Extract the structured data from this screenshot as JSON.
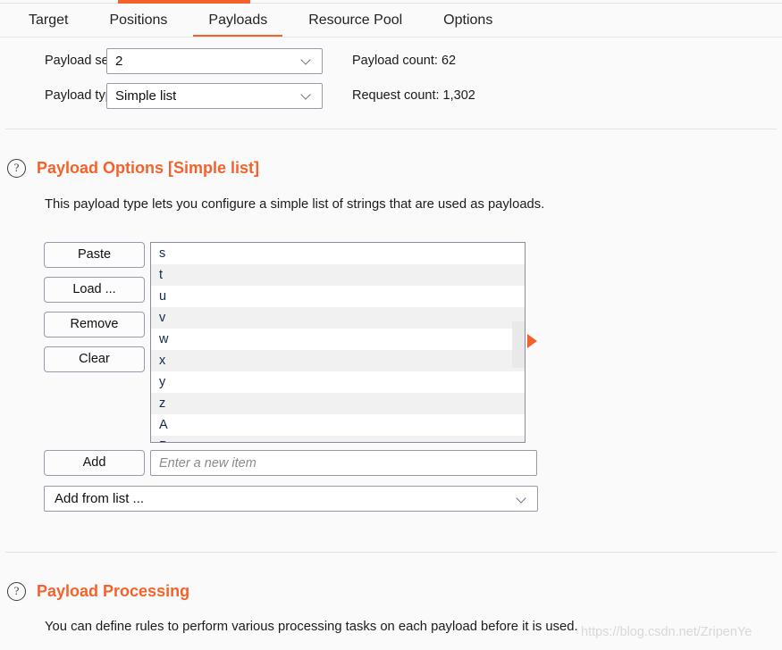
{
  "tabs": [
    {
      "label": "Target",
      "active": false
    },
    {
      "label": "Positions",
      "active": false
    },
    {
      "label": "Payloads",
      "active": true
    },
    {
      "label": "Resource Pool",
      "active": false
    },
    {
      "label": "Options",
      "active": false
    }
  ],
  "form": {
    "payload_set_label": "Payload set:",
    "payload_set_value": "2",
    "payload_type_label": "Payload type:",
    "payload_type_value": "Simple list",
    "payload_count_label": "Payload count:",
    "payload_count_value": "62",
    "request_count_label": "Request count:",
    "request_count_value": "1,302"
  },
  "payload_options": {
    "help_icon": "question-mark-icon",
    "title": "Payload Options [Simple list]",
    "description": "This payload type lets you configure a simple list of strings that are used as payloads.",
    "buttons": [
      {
        "label": "Paste"
      },
      {
        "label": "Load ..."
      },
      {
        "label": "Remove"
      },
      {
        "label": "Clear"
      }
    ],
    "list_items": [
      "s",
      "t",
      "u",
      "v",
      "w",
      "x",
      "y",
      "z",
      "A",
      "B"
    ],
    "add_button_label": "Add",
    "add_input_value": "",
    "add_input_placeholder": "Enter a new item",
    "add_from_list_label": "Add from list ...",
    "pointer_icon": "play-triangle-icon",
    "scrollbar_icon": "vertical-scrollbar"
  },
  "payload_processing": {
    "help_icon": "question-mark-icon",
    "title": "Payload Processing",
    "description": "You can define rules to perform various processing tasks on each payload before it is used."
  },
  "watermark": "https://blog.csdn.net/ZripenYe",
  "colors": {
    "accent": "#f4622c",
    "text": "#1a1a1a",
    "list_text": "#12294b",
    "background": "#fafafa",
    "divider": "#e3e3e3",
    "control_border": "#9b98ab"
  }
}
